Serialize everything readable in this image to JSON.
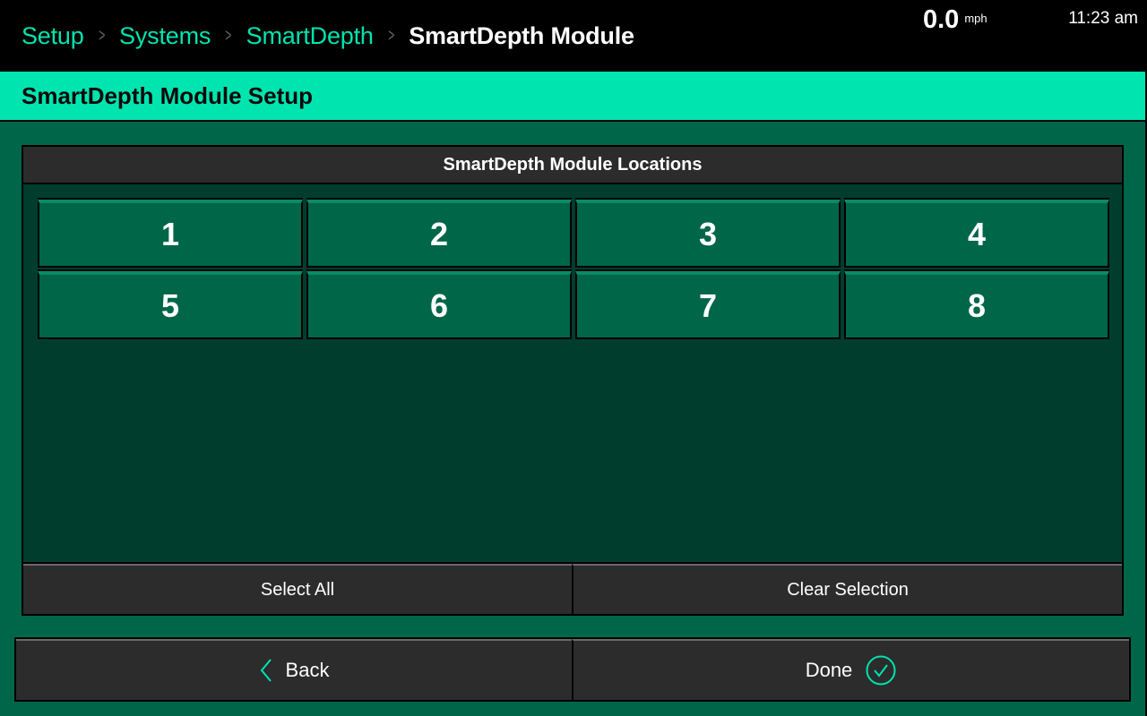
{
  "topbar": {
    "breadcrumbs": [
      {
        "label": "Setup"
      },
      {
        "label": "Systems"
      },
      {
        "label": "SmartDepth"
      },
      {
        "label": "SmartDepth Module"
      }
    ],
    "separator_icon": "chevron-right-icon",
    "speed": {
      "value": "0.0",
      "unit": "mph"
    },
    "clock": "11:23 am"
  },
  "titlebar": {
    "title": "SmartDepth Module Setup"
  },
  "panel": {
    "header": "SmartDepth Module Locations",
    "locations": [
      {
        "label": "1"
      },
      {
        "label": "2"
      },
      {
        "label": "3"
      },
      {
        "label": "4"
      },
      {
        "label": "5"
      },
      {
        "label": "6"
      },
      {
        "label": "7"
      },
      {
        "label": "8"
      }
    ],
    "select_all_label": "Select All",
    "clear_selection_label": "Clear Selection"
  },
  "footer": {
    "back_label": "Back",
    "back_icon": "chevron-left-icon",
    "done_label": "Done",
    "done_icon": "check-circle-icon"
  },
  "colors": {
    "accent": "#00e4b0",
    "background": "#00664a",
    "panel_background": "#003d2c",
    "button_green": "#006648",
    "button_dark": "#2c2c2c"
  }
}
